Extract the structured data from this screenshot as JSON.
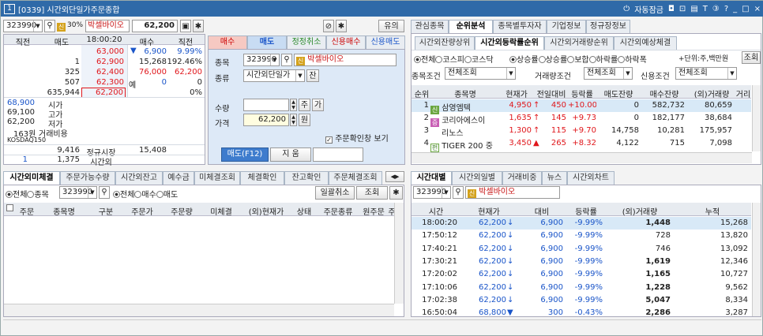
{
  "window": {
    "num": "1",
    "title": "[0339] 시간외단일가주문종합",
    "autolock": "자동잠금",
    "mode_icons": [
      "◘",
      "⊡",
      "▤",
      "T",
      "③",
      "?",
      "_",
      "□",
      "×"
    ]
  },
  "left_top": {
    "code": "323990",
    "tag1": "신",
    "pct": "30%",
    "name": "박셀바이오",
    "price": "62,200",
    "btn_yu": "유의"
  },
  "quote_headers": [
    "직전",
    "매도",
    "18:00:20",
    "매수",
    "직전"
  ],
  "ask_rows": [
    {
      "ask": "63,000",
      "arrow": "▼",
      "bid_qty": "6,900",
      "bid_pct": "9.99%"
    },
    {
      "ask_qty": "1",
      "ask": "62,900",
      "bid_qty": "15,268",
      "bid_pct": "192.46%"
    },
    {
      "ask_qty": "325",
      "ask": "62,400",
      "bid_qty": "76,000",
      "bid_pct": "62,200"
    },
    {
      "ask_qty": "507",
      "ask": "62,300",
      "label": "예",
      "bid_qty": "0",
      "bid_pct": "0"
    },
    {
      "ask_qty": "635,944",
      "ask": "62,200",
      "bid_pct": "0%"
    }
  ],
  "bid_info": [
    {
      "val": "68,900",
      "lbl": "시가"
    },
    {
      "val": "69,100",
      "lbl": "고가"
    },
    {
      "val": "62,200",
      "lbl": "저가"
    },
    {
      "val": "163원",
      "lbl": "거래비용"
    },
    {
      "val": "KOSDAQ150",
      "lbl": ""
    }
  ],
  "totals": {
    "sell_total": "9,416",
    "label1": "정규시장",
    "buy_total": "15,408",
    "sell_after": "1",
    "after_qty": "1,375",
    "label2": "시간외"
  },
  "order": {
    "tabs": [
      "매수",
      "매도",
      "정정취소",
      "신용매수",
      "신용매도"
    ],
    "stock_label": "종목",
    "stock_code": "323990",
    "stock_tag": "신",
    "stock_name": "박셀바이오",
    "type_label": "종류",
    "type_value": "시간외단일가",
    "type_btn": "잔",
    "qty_label": "수량",
    "qty_btn": "주",
    "qty_btn2": "가",
    "price_label": "가격",
    "price_value": "62,200",
    "price_unit": "원",
    "confirm": "주문확인창 보기",
    "sell_btn": "매도(F12)",
    "clear_btn": "지 움"
  },
  "right_tabs": [
    "관심종목",
    "순위분석",
    "종목별투자자",
    "기업정보",
    "정규장정보"
  ],
  "rank_subtabs": [
    "시간외잔량상위",
    "시간외등락률순위",
    "시간외거래량순위",
    "시간외예상체결"
  ],
  "rank_filters": {
    "market": [
      "전체",
      "코스피",
      "코스닥"
    ],
    "dir": [
      "상승률",
      "상승률",
      "보합",
      "하락률",
      "하락폭"
    ],
    "unit": "+단위:주,백만원",
    "search": "조회",
    "cond1_label": "종목조건",
    "cond1": "전체조회",
    "cond2_label": "거래량조건",
    "cond2": "전체조회",
    "cond3_label": "신용조건",
    "cond3": "전체조회"
  },
  "rank_headers": [
    "순위",
    "종목명",
    "현재가",
    "전일대비",
    "등락률",
    "매도잔량",
    "매수잔량",
    "(외)거래량",
    "거리"
  ],
  "rank_rows": [
    {
      "rank": "1",
      "tag": "신",
      "tagc": "S",
      "name": "삼영엠텍",
      "price": "4,950",
      "arrow": "↑",
      "chg": "450",
      "rate": "+10.00",
      "ask": "0",
      "bid": "582,732",
      "vol": "80,659"
    },
    {
      "rank": "2",
      "tag": "증",
      "tagc": "C",
      "name": "코리아에스이",
      "price": "1,635",
      "arrow": "↑",
      "chg": "145",
      "rate": "+9.73",
      "ask": "0",
      "bid": "182,177",
      "vol": "38,684"
    },
    {
      "rank": "3",
      "tag": "",
      "tagc": "",
      "name": "리노스",
      "price": "1,300",
      "arrow": "↑",
      "chg": "115",
      "rate": "+9.70",
      "ask": "14,758",
      "bid": "10,281",
      "vol": "175,957"
    },
    {
      "rank": "4",
      "tag": "펀",
      "tagc": "P",
      "name": "TIGER 200 중",
      "price": "3,450",
      "arrow": "▲",
      "chg": "265",
      "rate": "+8.32",
      "ask": "4,122",
      "bid": "715",
      "vol": "7,098"
    }
  ],
  "bottom_left_tabs": [
    "시간외미체결",
    "주문가능수량",
    "시간외잔고",
    "예수금",
    "미체결조회",
    "체결확인",
    "잔고확인",
    "주문체결조회"
  ],
  "bottom_left_filters": {
    "all": "전체",
    "stock": "종목",
    "code": "323990",
    "all2": "전체",
    "buy": "매수",
    "sell": "매도",
    "batch_cancel": "일괄취소",
    "search": "조회"
  },
  "unfilled_headers": [
    "주문",
    "종목명",
    "구분",
    "주문가",
    "주문량",
    "미체결",
    "(외)현재가",
    "상태",
    "주문종류",
    "원주문",
    "주"
  ],
  "bottom_right_tabs": [
    "시간대별",
    "시간외일별",
    "거래비중",
    "뉴스",
    "시간외차트"
  ],
  "time_search": {
    "code": "323990",
    "tag": "신",
    "name": "박셀바이오"
  },
  "time_headers": [
    "시간",
    "현재가",
    "대비",
    "등락률",
    "(외)거래량",
    "누적"
  ],
  "time_rows": [
    {
      "t": "18:00:20",
      "p": "62,200",
      "a": "↓",
      "d": "6,900",
      "r": "-9.99%",
      "v": "1,448",
      "cum": "15,268",
      "bold": true
    },
    {
      "t": "17:50:12",
      "p": "62,200",
      "a": "↓",
      "d": "6,900",
      "r": "-9.99%",
      "v": "728",
      "cum": "13,820",
      "bold": false
    },
    {
      "t": "17:40:21",
      "p": "62,200",
      "a": "↓",
      "d": "6,900",
      "r": "-9.99%",
      "v": "746",
      "cum": "13,092",
      "bold": false
    },
    {
      "t": "17:30:21",
      "p": "62,200",
      "a": "↓",
      "d": "6,900",
      "r": "-9.99%",
      "v": "1,619",
      "cum": "12,346",
      "bold": true
    },
    {
      "t": "17:20:02",
      "p": "62,200",
      "a": "↓",
      "d": "6,900",
      "r": "-9.99%",
      "v": "1,165",
      "cum": "10,727",
      "bold": true
    },
    {
      "t": "17:10:06",
      "p": "62,200",
      "a": "↓",
      "d": "6,900",
      "r": "-9.99%",
      "v": "1,228",
      "cum": "9,562",
      "bold": true
    },
    {
      "t": "17:02:38",
      "p": "62,200",
      "a": "↓",
      "d": "6,900",
      "r": "-9.99%",
      "v": "5,047",
      "cum": "8,334",
      "bold": true
    },
    {
      "t": "16:50:04",
      "p": "68,800",
      "a": "▼",
      "d": "300",
      "r": "-0.43%",
      "v": "2,286",
      "cum": "3,287",
      "bold": true
    }
  ]
}
